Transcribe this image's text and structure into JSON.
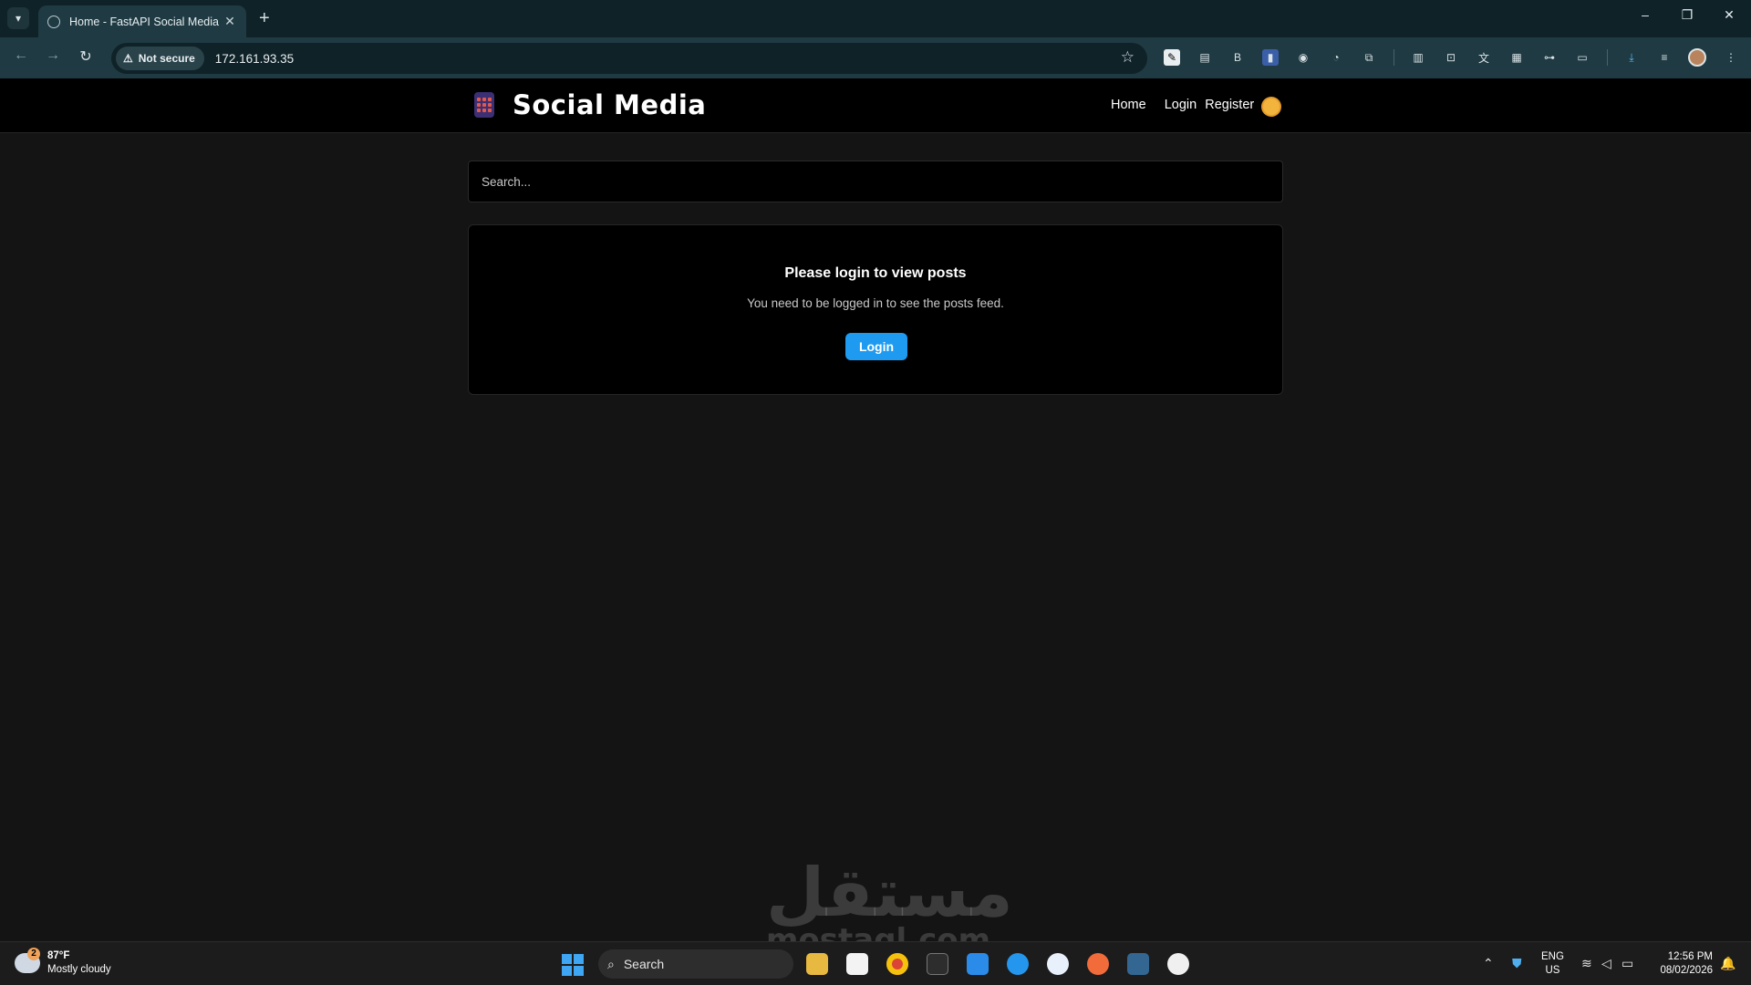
{
  "browser": {
    "tab_title": "Home - FastAPI Social Media",
    "security_label": "Not secure",
    "url": "172.161.93.35"
  },
  "navbar": {
    "brand": "Social Media",
    "links": [
      "Home",
      "Login",
      "Register"
    ]
  },
  "search": {
    "placeholder": "Search..."
  },
  "card": {
    "title": "Please login to view posts",
    "text": "You need to be logged in to see the posts feed.",
    "button": "Login"
  },
  "watermark": {
    "arabic": "مستقل",
    "latin": "mostaql.com"
  },
  "taskbar": {
    "weather_badge": "2",
    "temperature": "87°F",
    "condition": "Mostly cloudy",
    "search_label": "Search",
    "lang_line1": "ENG",
    "lang_line2": "US",
    "time": "12:56 PM",
    "date": "08/02/2026"
  },
  "colors": {
    "accent": "#1e9bf0",
    "page_bg": "#141414",
    "card_bg": "#000000",
    "chrome_bg": "#1f3a43"
  }
}
